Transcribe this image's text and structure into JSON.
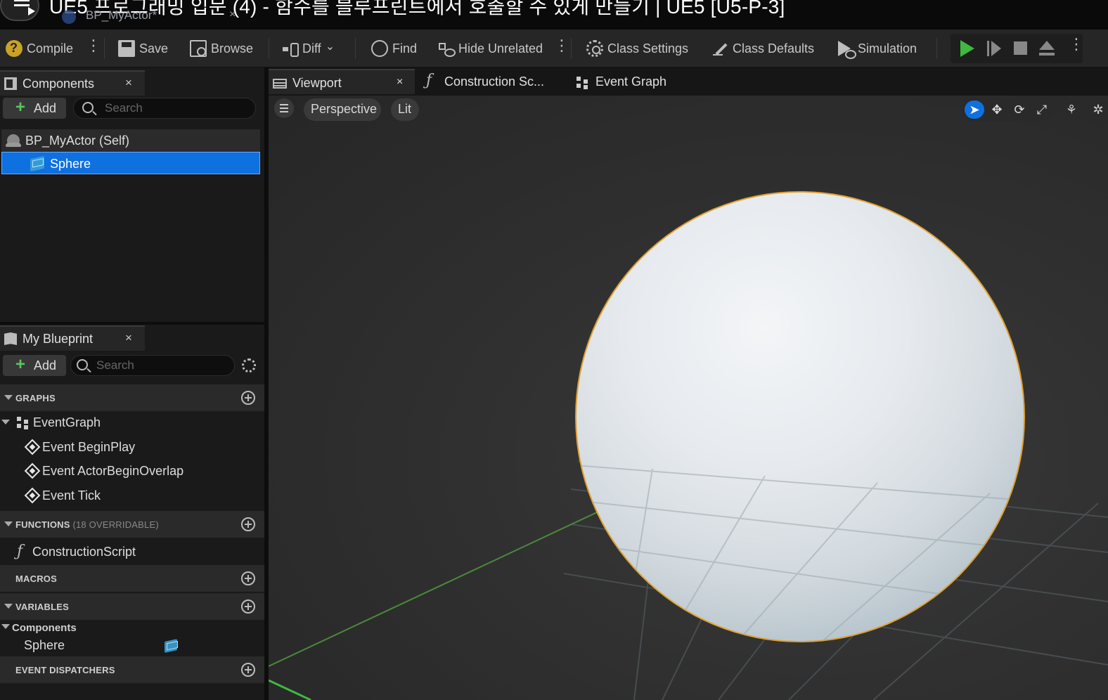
{
  "window": {
    "video_title": "UE5 프로그래밍 입문 (4) - 함수를 블루프린트에서 호출할 수 있게 만들기 | UE5 [U5-P-3]",
    "document_tab": "BP_MyActor*",
    "close_glyph": "×"
  },
  "toolbar": {
    "compile": "Compile",
    "save": "Save",
    "browse": "Browse",
    "diff": "Diff",
    "find": "Find",
    "hide_unrelated": "Hide Unrelated",
    "class_settings": "Class Settings",
    "class_defaults": "Class Defaults",
    "simulation": "Simulation",
    "dropdown_glyph": "⌄"
  },
  "components_panel": {
    "tab_label": "Components",
    "close_glyph": "×",
    "add_label": "Add",
    "add_glyph": "+",
    "search_placeholder": "Search",
    "tree": [
      {
        "label": "BP_MyActor (Self)",
        "selected": false
      },
      {
        "label": "Sphere",
        "selected": true
      }
    ]
  },
  "my_blueprint": {
    "tab_label": "My Blueprint",
    "close_glyph": "×",
    "add_label": "Add",
    "add_glyph": "+",
    "search_placeholder": "Search",
    "sections": {
      "graphs": "GRAPHS",
      "functions": "FUNCTIONS",
      "functions_note": "(18 OVERRIDABLE)",
      "macros": "MACROS",
      "variables": "VARIABLES",
      "event_dispatchers": "EVENT DISPATCHERS"
    },
    "event_graph": "EventGraph",
    "events": [
      "Event BeginPlay",
      "Event ActorBeginOverlap",
      "Event Tick"
    ],
    "function_items": [
      "ConstructionScript"
    ],
    "variable_category": "Components",
    "variable_items": [
      "Sphere"
    ],
    "function_glyph": "ƒ"
  },
  "editor_tabs": {
    "viewport": "Viewport",
    "construction_script": "Construction Sc...",
    "event_graph": "Event Graph",
    "close_glyph": "×",
    "function_glyph": "ƒ"
  },
  "viewport": {
    "view_mode": "Perspective",
    "lighting": "Lit",
    "tools": [
      "➤",
      "✥",
      "⟳",
      "⤢"
    ],
    "extra_tools": [
      "⚘",
      "✲"
    ],
    "selection_outline_color": "#e0a030",
    "axis_color": "#4a8a3a"
  },
  "colors": {
    "selection": "#0f70e0",
    "play": "#3fb83f",
    "add": "#5cc45c",
    "compile_warning": "#c9a227"
  }
}
